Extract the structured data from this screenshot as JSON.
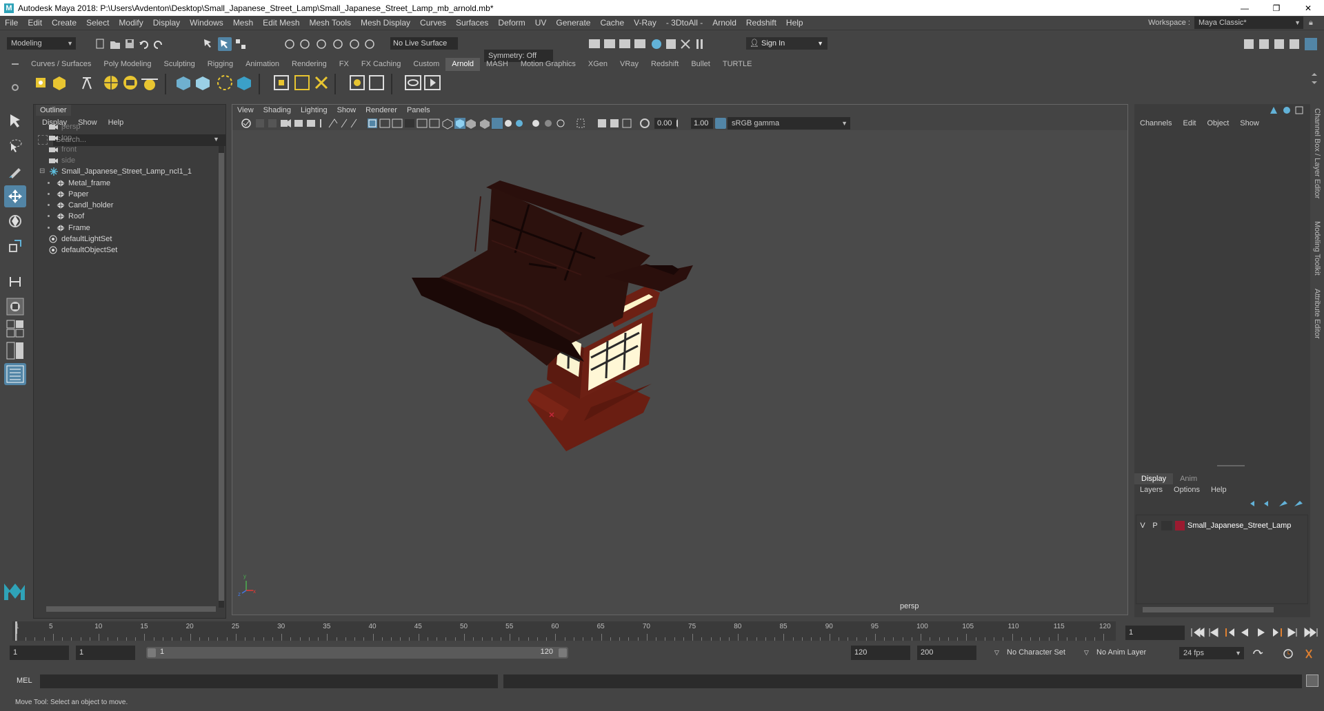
{
  "window": {
    "title": "Autodesk Maya 2018: P:\\Users\\Avdenton\\Desktop\\Small_Japanese_Street_Lamp\\Small_Japanese_Street_Lamp_mb_arnold.mb*",
    "minimize": "—",
    "maximize": "❐",
    "close": "✕"
  },
  "menubar": {
    "items": [
      "File",
      "Edit",
      "Create",
      "Select",
      "Modify",
      "Display",
      "Windows",
      "Mesh",
      "Edit Mesh",
      "Mesh Tools",
      "Mesh Display",
      "Curves",
      "Surfaces",
      "Deform",
      "UV",
      "Generate",
      "Cache",
      "V-Ray",
      "- 3DtoAll -",
      "Arnold",
      "Redshift",
      "Help"
    ],
    "workspace_label": "Workspace :",
    "workspace_value": "Maya Classic*"
  },
  "statusline": {
    "mode": "Modeling",
    "live_surface": "No Live Surface",
    "symmetry": "Symmetry: Off",
    "sign_in": "Sign In"
  },
  "shelf": {
    "tabs": [
      "Curves / Surfaces",
      "Poly Modeling",
      "Sculpting",
      "Rigging",
      "Animation",
      "Rendering",
      "FX",
      "FX Caching",
      "Custom",
      "Arnold",
      "MASH",
      "Motion Graphics",
      "XGen",
      "VRay",
      "Redshift",
      "Bullet",
      "TURTLE"
    ],
    "active_tab": "Arnold"
  },
  "outliner": {
    "title": "Outliner",
    "menu": [
      "Display",
      "Show",
      "Help"
    ],
    "search_placeholder": "Search...",
    "cameras": [
      "persp",
      "top",
      "front",
      "side"
    ],
    "group": "Small_Japanese_Street_Lamp_ncl1_1",
    "children": [
      "Metal_frame",
      "Paper",
      "Candl_holder",
      "Roof",
      "Frame"
    ],
    "sets": [
      "defaultLightSet",
      "defaultObjectSet"
    ]
  },
  "viewport": {
    "menu": [
      "View",
      "Shading",
      "Lighting",
      "Show",
      "Renderer",
      "Panels"
    ],
    "exposure": "0.00",
    "gamma": "1.00",
    "color_space": "sRGB gamma",
    "camera_label": "persp"
  },
  "channelbox": {
    "menu": [
      "Channels",
      "Edit",
      "Object",
      "Show"
    ],
    "layer_tabs": [
      "Display",
      "Anim"
    ],
    "layer_menu": [
      "Layers",
      "Options",
      "Help"
    ],
    "layer": {
      "v": "V",
      "p": "P",
      "name": "Small_Japanese_Street_Lamp",
      "color": "#9b1b30"
    }
  },
  "side_tabs": [
    "Channel Box / Layer Editor",
    "Modeling Toolkit",
    "Attribute Editor"
  ],
  "timeline": {
    "ticks": [
      "1",
      "5",
      "10",
      "15",
      "20",
      "25",
      "30",
      "35",
      "40",
      "45",
      "50",
      "55",
      "60",
      "65",
      "70",
      "75",
      "80",
      "85",
      "90",
      "95",
      "100",
      "105",
      "110",
      "115",
      "120"
    ],
    "current_frame": "1"
  },
  "range": {
    "start": "1",
    "start_inner": "1",
    "slider_start": "1",
    "slider_end": "120",
    "end_inner": "120",
    "end": "200",
    "character_set": "No Character Set",
    "anim_layer": "No Anim Layer",
    "fps": "24 fps"
  },
  "cmdline": {
    "label": "MEL"
  },
  "helpline": {
    "text": "Move Tool: Select an object to move."
  }
}
